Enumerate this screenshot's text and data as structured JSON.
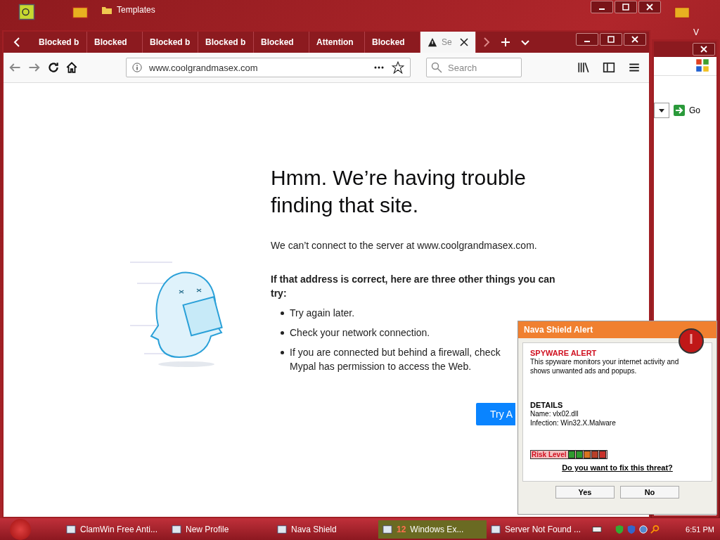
{
  "desktop": {
    "icons": [
      {
        "label": "Templates"
      }
    ],
    "corner_letter": "V"
  },
  "browser": {
    "tabs": [
      {
        "label": "Blocked b",
        "selected": false,
        "warning": false
      },
      {
        "label": "Blocked",
        "selected": false,
        "warning": false
      },
      {
        "label": "Blocked b",
        "selected": false,
        "warning": false
      },
      {
        "label": "Blocked b",
        "selected": false,
        "warning": false
      },
      {
        "label": "Blocked",
        "selected": false,
        "warning": false
      },
      {
        "label": "Attention",
        "selected": false,
        "warning": false
      },
      {
        "label": "Blocked",
        "selected": false,
        "warning": false
      },
      {
        "label": "Se",
        "selected": true,
        "warning": true
      }
    ],
    "url": "www.coolgrandmasex.com",
    "search": {
      "placeholder": "Search"
    },
    "error": {
      "heading": "Hmm. We’re having trouble finding that site.",
      "message": "We can’t connect to the server at www.coolgrandmasex.com.",
      "subheading": "If that address is correct, here are three other things you can try:",
      "items": [
        {
          "lines": [
            "Try again later."
          ]
        },
        {
          "lines": [
            "Check your network connection."
          ]
        },
        {
          "lines": [
            "If you are connected but behind a firewall, check",
            "Mypal has permission to access the Web."
          ]
        }
      ],
      "button": "Try A"
    }
  },
  "back_window": {
    "button": "Go"
  },
  "alert": {
    "title": "Nava Shield Alert",
    "heading": "SPYWARE ALERT",
    "description": "This spyware monitors your internet activity and shows unwanted ads and popups.",
    "details_heading": "DETAILS",
    "details": [
      "Name: vlx02.dll",
      "Infection: Win32.X.Malware"
    ],
    "risk_label": "Risk Level",
    "risk": [
      {
        "color": "#2e9a2e"
      },
      {
        "color": "#2e9a2e"
      },
      {
        "color": "#d9731f"
      },
      {
        "color": "#b8402a"
      },
      {
        "color": "#c8302a"
      }
    ],
    "question": "Do you want to fix this threat?",
    "buttons": [
      "Yes",
      "No"
    ]
  },
  "taskbar": {
    "items": [
      {
        "label": "ClamWin Free Anti...",
        "active": false
      },
      {
        "label": "New Profile",
        "active": false
      },
      {
        "label": "Nava Shield",
        "active": false
      },
      {
        "label": "Windows Ex...",
        "count": "12",
        "active": true
      },
      {
        "label": "Server Not Found ...",
        "active": false
      }
    ],
    "clock": "6:51 PM"
  }
}
